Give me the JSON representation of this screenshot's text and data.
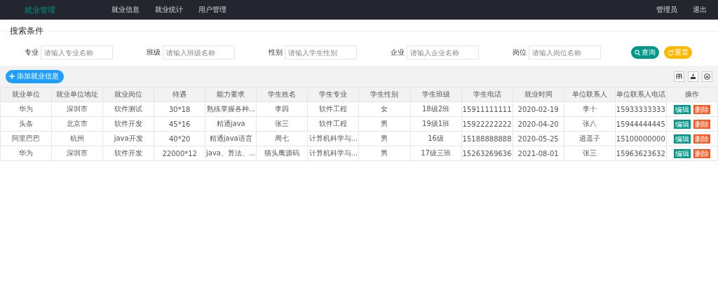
{
  "nav": {
    "logo": "就业管理",
    "menu": [
      {
        "label": "就业信息"
      },
      {
        "label": "就业统计"
      },
      {
        "label": "用户管理"
      }
    ],
    "user": "管理员",
    "logout": "退出"
  },
  "search": {
    "title": "搜索条件",
    "fields": [
      {
        "label": "专业",
        "placeholder": "请输入专业名称"
      },
      {
        "label": "班级",
        "placeholder": "请输入班级名称"
      },
      {
        "label": "性别",
        "placeholder": "请输入学生性别"
      },
      {
        "label": "企业",
        "placeholder": "请输入企业名称"
      },
      {
        "label": "岗位",
        "placeholder": "请输入岗位名称"
      }
    ],
    "buttons": [
      {
        "label": "查询",
        "kind": "search"
      },
      {
        "label": "重置",
        "kind": "reset"
      }
    ]
  },
  "toolbar": {
    "add_button": "添加就业信息"
  },
  "table": {
    "columns": [
      "就业单位",
      "就业单位地址",
      "就业岗位",
      "待遇",
      "能力要求",
      "学生姓名",
      "学生专业",
      "学生性别",
      "学生班级",
      "学生电话",
      "就业时间",
      "单位联系人",
      "单位联系人电话",
      "操作"
    ],
    "rows": [
      {
        "cells": [
          "华为",
          "深圳市",
          "软件测试",
          "30*18",
          "熟练掌握各种...",
          "李四",
          "软件工程",
          "女",
          "18级2班",
          "15911111111",
          "2020-02-19",
          "李十",
          "15933333333"
        ],
        "actions": [
          {
            "label": "编辑",
            "kind": "edit"
          },
          {
            "label": "删除",
            "kind": "delete"
          }
        ]
      },
      {
        "cells": [
          "头条",
          "北京市",
          "软件开发",
          "45*16",
          "精通java",
          "张三",
          "软件工程",
          "男",
          "19级1班",
          "15922222222",
          "2020-04-20",
          "张八",
          "15944444445"
        ],
        "actions": [
          {
            "label": "编辑",
            "kind": "edit"
          },
          {
            "label": "删除",
            "kind": "delete"
          }
        ]
      },
      {
        "cells": [
          "阿里巴巴",
          "杭州",
          "java开发",
          "40*20",
          "精通java语言",
          "周七",
          "计算机科学与...",
          "男",
          "16级",
          "15188888888",
          "2020-05-25",
          "逍遥子",
          "15100000000"
        ],
        "actions": [
          {
            "label": "编辑",
            "kind": "edit"
          },
          {
            "label": "删除",
            "kind": "delete"
          }
        ]
      },
      {
        "cells": [
          "华为",
          "深圳市",
          "软件开发",
          "22000*12",
          "java、算法、...",
          "猫头鹰源码",
          "计算机科学与...",
          "男",
          "17级三班",
          "15263269636",
          "2021-08-01",
          "张三",
          "15963623632"
        ],
        "actions": [
          {
            "label": "编辑",
            "kind": "edit"
          },
          {
            "label": "删除",
            "kind": "delete"
          }
        ]
      }
    ]
  }
}
